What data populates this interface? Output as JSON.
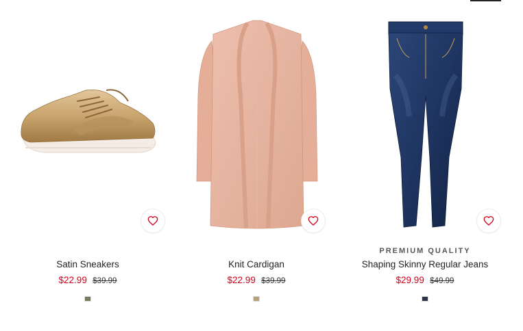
{
  "products": [
    {
      "name": "Satin Sneakers",
      "price": "$22.99",
      "old_price": "$39.99",
      "badge": "",
      "favorite_icon": "heart-outline-icon",
      "swatch_color": "#7b7b62",
      "accent": "#d0021b"
    },
    {
      "name": "Knit Cardigan",
      "price": "$22.99",
      "old_price": "$39.99",
      "badge": "",
      "favorite_icon": "heart-outline-icon",
      "swatch_color": "#b8a07a",
      "accent": "#d0021b"
    },
    {
      "name": "Shaping Skinny Regular Jeans",
      "price": "$29.99",
      "old_price": "$49.99",
      "badge": "PREMIUM QUALITY",
      "favorite_icon": "heart-outline-icon",
      "swatch_color": "#2d3448",
      "accent": "#d0021b"
    }
  ]
}
